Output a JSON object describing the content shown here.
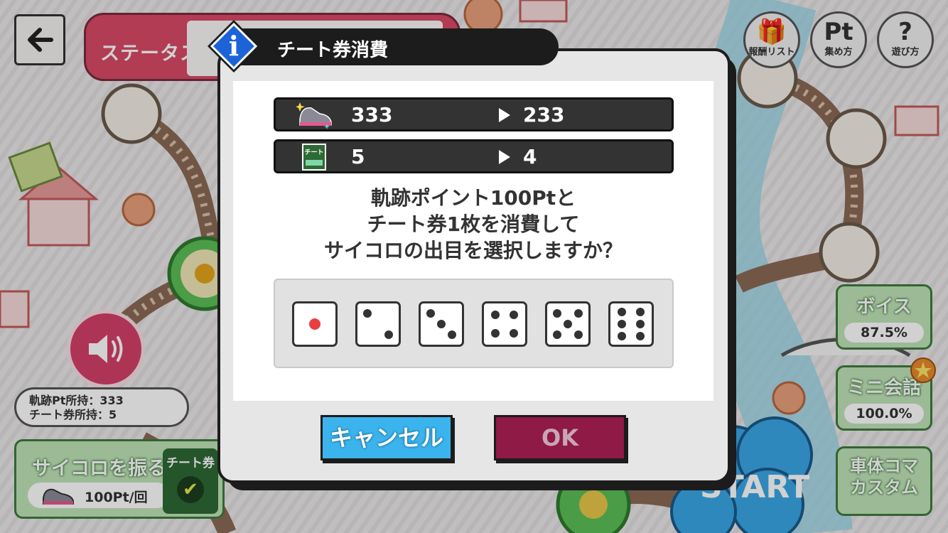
{
  "background": {
    "status_tab_label": "ステータス",
    "top_buttons": [
      {
        "icon": "gift-icon",
        "glyph": "🎁",
        "label": "報酬リスト"
      },
      {
        "icon": "pt-icon",
        "glyph": "Pt",
        "label": "集め方"
      },
      {
        "icon": "question-icon",
        "glyph": "?",
        "label": "遊び方"
      }
    ],
    "side_cards": {
      "voice": {
        "title": "ボイス",
        "percent": "87.5%"
      },
      "mini_talk": {
        "title": "ミニ会話",
        "percent": "100.0%"
      },
      "custom": {
        "title_line1": "車体コマ",
        "title_line2": "カスタム"
      }
    },
    "start_label": "START",
    "holdings": {
      "line1": "軌跡Pt所持：333",
      "line2": "チート券所持：5"
    },
    "roll_panel": {
      "title": "サイコロを振る",
      "cost": "100Pt/回",
      "cheat_label": "チート券",
      "cheat_check": "✔"
    }
  },
  "dialog": {
    "title": "チート券消費",
    "info_glyph": "i",
    "rows": [
      {
        "icon": "sneaker-icon",
        "from": "333",
        "to": "233"
      },
      {
        "icon": "cheat-ticket-icon",
        "ticket_text": "チート",
        "from": "5",
        "to": "4"
      }
    ],
    "message_lines": [
      "軌跡ポイント100Ptと",
      "チート券1枚を消費して",
      "サイコロの出目を選択しますか？"
    ],
    "dice_faces": [
      1,
      2,
      3,
      4,
      5,
      6
    ],
    "cancel_label": "キャンセル",
    "ok_label": "OK"
  },
  "colors": {
    "accent_blue": "#3bb4ee",
    "ok_maroon": "#8e1a45",
    "panel_dark": "#333333",
    "green_card": "#bfe3b7",
    "status_pink": "#d84a67"
  }
}
